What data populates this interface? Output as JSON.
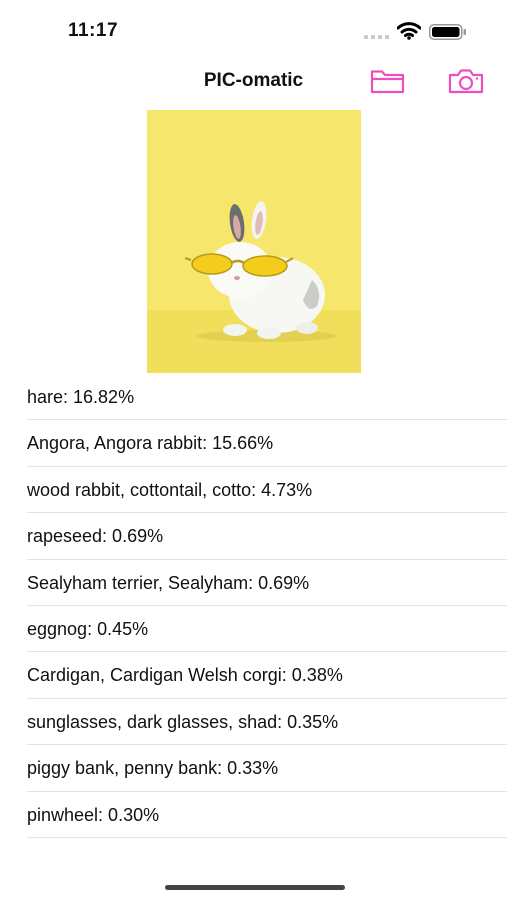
{
  "status_bar": {
    "time": "11:17"
  },
  "nav": {
    "title": "PIC-omatic",
    "folder_icon": "folder-icon",
    "camera_icon": "camera-icon"
  },
  "colors": {
    "accent": "#ee4fbf",
    "photo_background": "#f6e66c",
    "separator": "#e3e3e6"
  },
  "photo": {
    "subject": "white rabbit wearing yellow sunglasses"
  },
  "results": [
    {
      "label": "hare: 16.82%"
    },
    {
      "label": "Angora, Angora rabbit: 15.66%"
    },
    {
      "label": "wood rabbit, cottontail, cotto: 4.73%"
    },
    {
      "label": "rapeseed: 0.69%"
    },
    {
      "label": "Sealyham terrier, Sealyham: 0.69%"
    },
    {
      "label": "eggnog: 0.45%"
    },
    {
      "label": "Cardigan, Cardigan Welsh corgi: 0.38%"
    },
    {
      "label": "sunglasses, dark glasses, shad: 0.35%"
    },
    {
      "label": "piggy bank, penny bank: 0.33%"
    },
    {
      "label": "pinwheel: 0.30%"
    }
  ]
}
